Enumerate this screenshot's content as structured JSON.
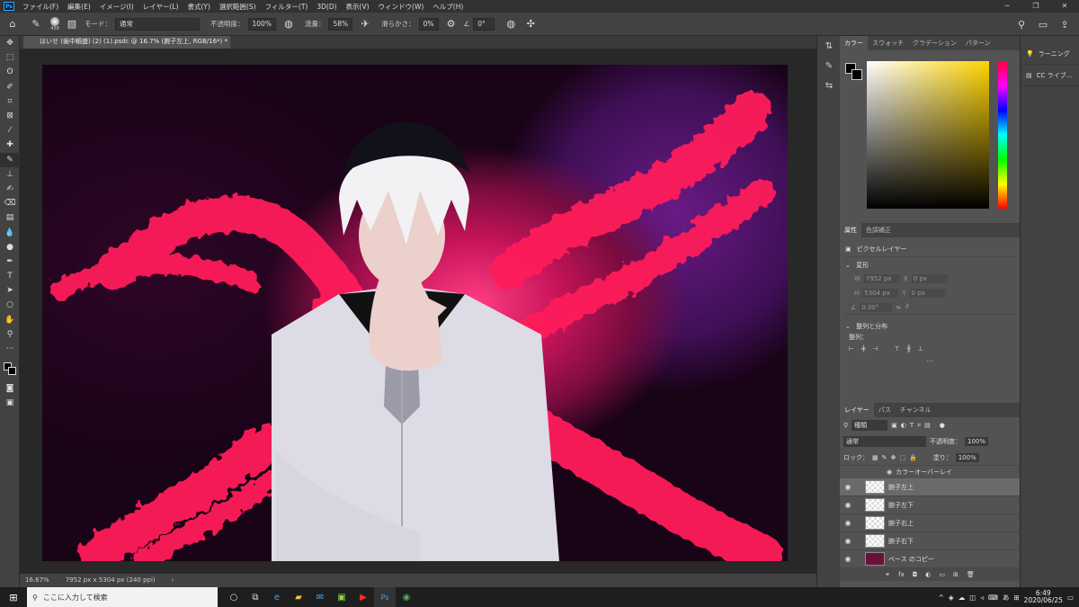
{
  "menu": {
    "items": [
      "ファイル(F)",
      "編集(E)",
      "イメージ(I)",
      "レイヤー(L)",
      "書式(Y)",
      "選択範囲(S)",
      "フィルター(T)",
      "3D(D)",
      "表示(V)",
      "ウィンドウ(W)",
      "ヘルプ(H)"
    ],
    "app_logo": "Ps"
  },
  "options": {
    "brush_size": "438",
    "mode_label": "モード：",
    "mode_value": "通常",
    "opacity_label": "不透明度：",
    "opacity_value": "100%",
    "flow_label": "流量：",
    "flow_value": "58%",
    "smoothing_label": "滑らかさ：",
    "smoothing_value": "0%",
    "angle_value": "0°"
  },
  "document": {
    "tab_title": "はいせ (歯中頼盛) (2) (1).psdc @ 16.7% (腕子左上, RGB/16*) *",
    "zoom": "16.67%",
    "dimensions": "7952 px x 5304 px (240 ppi)"
  },
  "color_panel": {
    "tabs": [
      "カラー",
      "スウォッチ",
      "グラデーション",
      "パターン"
    ]
  },
  "properties_panel": {
    "tabs": [
      "属性",
      "色調補正"
    ],
    "layer_type": "ピクセルレイヤー",
    "transform_label": "変形",
    "w_label": "W",
    "w_value": "7952 px",
    "x_label": "X",
    "x_value": "0 px",
    "h_label": "H",
    "h_value": "5304 px",
    "y_label": "Y",
    "y_value": "0 px",
    "angle_value": "0.00°",
    "align_label": "整列と分布",
    "align_sub": "整列："
  },
  "layers_panel": {
    "tabs": [
      "レイヤー",
      "パス",
      "チャンネル"
    ],
    "kind_label": "種類",
    "blend_mode": "通常",
    "opacity_label": "不透明度：",
    "opacity_value": "100%",
    "lock_label": "ロック：",
    "fill_label": "塗り：",
    "fill_value": "100%",
    "effect_label": "カラーオーバーレイ",
    "layers": [
      {
        "name": "腕子左上",
        "selected": true
      },
      {
        "name": "腕子左下",
        "selected": false
      },
      {
        "name": "腕子右上",
        "selected": false
      },
      {
        "name": "腕子右下",
        "selected": false
      },
      {
        "name": "ベース のコピー",
        "selected": false
      }
    ]
  },
  "side_panel": {
    "items": [
      "ラーニング",
      "CC ライブ..."
    ]
  },
  "taskbar": {
    "search_placeholder": "ここに入力して検索",
    "time": "6:49",
    "date": "2020/06/25",
    "ime": "あ"
  },
  "colors": {
    "accent_pink": "#ff1f5a",
    "ps_blue": "#31a8ff"
  }
}
